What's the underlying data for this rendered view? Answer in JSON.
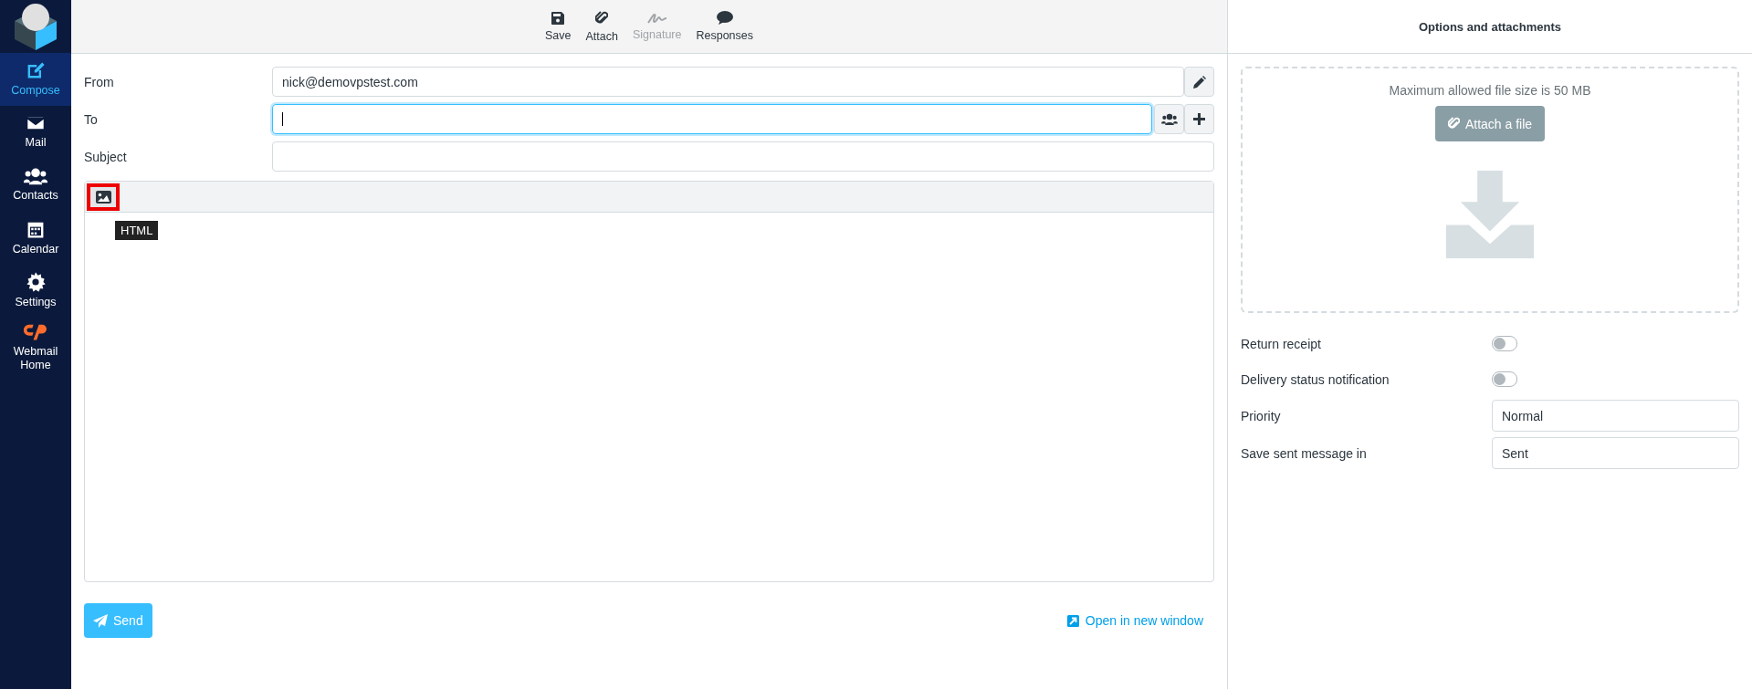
{
  "sidebar": {
    "items": [
      {
        "kind": "compose",
        "label": "Compose",
        "selected": true
      },
      {
        "kind": "mail",
        "label": "Mail",
        "selected": false
      },
      {
        "kind": "contacts",
        "label": "Contacts",
        "selected": false
      },
      {
        "kind": "calendar",
        "label": "Calendar",
        "selected": false
      },
      {
        "kind": "settings",
        "label": "Settings",
        "selected": false
      },
      {
        "kind": "cpanel",
        "label": "Webmail Home",
        "selected": false
      }
    ]
  },
  "toolbar": {
    "buttons": [
      {
        "kind": "save",
        "label": "Save",
        "disabled": false
      },
      {
        "kind": "attach",
        "label": "Attach",
        "disabled": false
      },
      {
        "kind": "signature",
        "label": "Signature",
        "disabled": true
      },
      {
        "kind": "responses",
        "label": "Responses",
        "disabled": false
      }
    ]
  },
  "form": {
    "fields": [
      {
        "kind": "from",
        "label": "From",
        "value": "nick@demovpstest.com"
      },
      {
        "kind": "to",
        "label": "To"
      },
      {
        "kind": "subject",
        "label": "Subject"
      }
    ]
  },
  "editor": {
    "mode_button": {
      "highlighted": true
    },
    "tooltip": "HTML"
  },
  "send_button": "Send",
  "open_new_window": "Open in new window",
  "options": {
    "title": "Options and attachments",
    "dropzone": {
      "hint": "Maximum allowed file size is 50 MB",
      "button": "Attach a file"
    },
    "rows": [
      {
        "kind": "toggle",
        "label": "Return receipt",
        "on": false
      },
      {
        "kind": "toggle",
        "label": "Delivery status notification",
        "on": false
      },
      {
        "kind": "select",
        "label": "Priority",
        "value": "Normal"
      },
      {
        "kind": "select",
        "label": "Save sent message in",
        "value": "Sent"
      }
    ]
  }
}
